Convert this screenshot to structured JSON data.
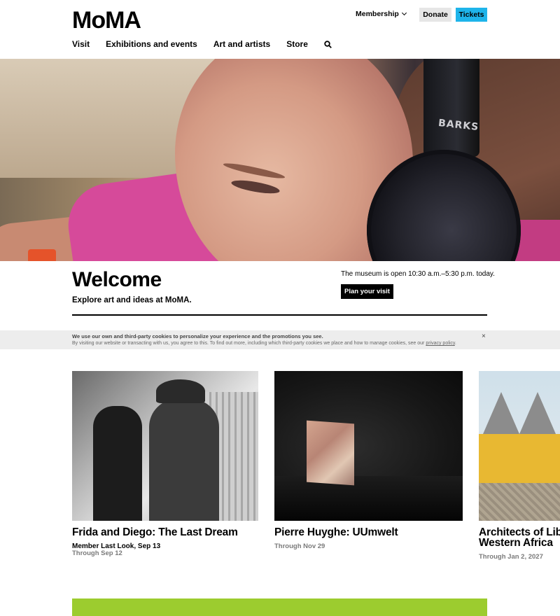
{
  "header": {
    "logo": "MoMA",
    "membership_label": "Membership",
    "donate_label": "Donate",
    "tickets_label": "Tickets",
    "accent_color": "#1eb4ea"
  },
  "nav": {
    "items": [
      {
        "label": "Visit"
      },
      {
        "label": "Exhibitions and events"
      },
      {
        "label": "Art and artists"
      },
      {
        "label": "Store"
      }
    ],
    "search_icon": "search-icon"
  },
  "hero": {
    "headphone_text": "BARKS"
  },
  "welcome": {
    "title": "Welcome",
    "subtitle": "Explore art and ideas at MoMA.",
    "hours": "The museum is open 10:30 a.m.–5:30 p.m. today.",
    "plan_label": "Plan your visit"
  },
  "cookie": {
    "title": "We use our own and third-party cookies to personalize your experience and the promotions you see.",
    "text": "By visiting our website or transacting with us, you agree to this. To find out more, including which third-party cookies we place and how to manage cookies, see our",
    "link": "privacy policy",
    "link_suffix": ".",
    "close": "×"
  },
  "cards": [
    {
      "title": "Frida and Diego: The Last Dream",
      "subtitle": "Member Last Look, Sep 13",
      "date": "Through Sep 12"
    },
    {
      "title": "Pierre Huyghe: UUmwelt",
      "date": "Through Nov 29"
    },
    {
      "title_line1": "Architects of Lib",
      "title_line2": "Western Africa",
      "date": "Through Jan 2, 2027"
    }
  ],
  "colors": {
    "banner_green": "#9ccc2f",
    "cookie_bg": "#ededed"
  }
}
